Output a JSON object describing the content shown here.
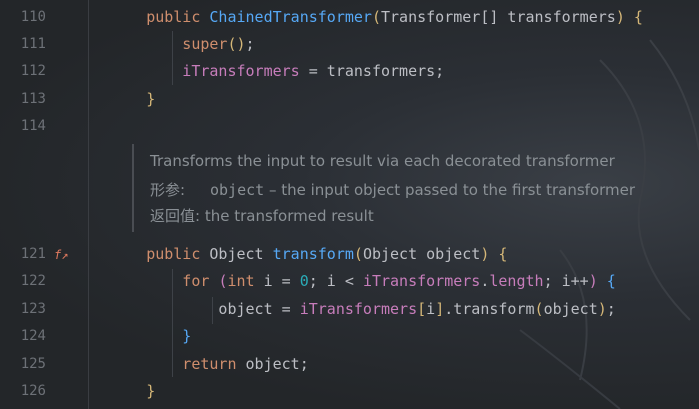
{
  "colors": {
    "keyword": "#cf8e6d",
    "function": "#56a8f5",
    "field": "#c77dbb",
    "number": "#2aacb8",
    "text": "#bcbec4",
    "line_number": "#6d7177",
    "doc_text": "#8a9095"
  },
  "lines": [
    {
      "num": "110",
      "tokens": [
        {
          "t": "public ",
          "c": "kw"
        },
        {
          "t": "ChainedTransformer",
          "c": "fn"
        },
        {
          "t": "(",
          "c": "br1"
        },
        {
          "t": "Transformer[] transformers",
          "c": "tx"
        },
        {
          "t": ")",
          "c": "br1"
        },
        {
          "t": " {",
          "c": "br1"
        }
      ]
    },
    {
      "num": "111",
      "tokens": [
        {
          "t": "    super",
          "c": "kw"
        },
        {
          "t": "()",
          "c": "br1"
        },
        {
          "t": ";",
          "c": "tx"
        }
      ]
    },
    {
      "num": "112",
      "tokens": [
        {
          "t": "    iTransformers",
          "c": "cl"
        },
        {
          "t": " = transformers;",
          "c": "tx"
        }
      ]
    },
    {
      "num": "113",
      "tokens": [
        {
          "t": "}",
          "c": "br1"
        }
      ]
    },
    {
      "num": "114",
      "tokens": []
    },
    {
      "num": "121",
      "icon": "override-icon",
      "tokens": [
        {
          "t": "public ",
          "c": "kw"
        },
        {
          "t": "Object ",
          "c": "tx"
        },
        {
          "t": "transform",
          "c": "fn"
        },
        {
          "t": "(",
          "c": "br1"
        },
        {
          "t": "Object object",
          "c": "tx"
        },
        {
          "t": ")",
          "c": "br1"
        },
        {
          "t": " {",
          "c": "br1"
        }
      ]
    },
    {
      "num": "122",
      "tokens": [
        {
          "t": "    for ",
          "c": "kw"
        },
        {
          "t": "(",
          "c": "br2"
        },
        {
          "t": "int ",
          "c": "kw"
        },
        {
          "t": "i = ",
          "c": "tx"
        },
        {
          "t": "0",
          "c": "num"
        },
        {
          "t": "; i < ",
          "c": "tx"
        },
        {
          "t": "iTransformers",
          "c": "cl"
        },
        {
          "t": ".",
          "c": "tx"
        },
        {
          "t": "length",
          "c": "cl"
        },
        {
          "t": "; i++",
          "c": "tx"
        },
        {
          "t": ")",
          "c": "br2"
        },
        {
          "t": " {",
          "c": "fn"
        }
      ]
    },
    {
      "num": "123",
      "tokens": [
        {
          "t": "        object = ",
          "c": "tx"
        },
        {
          "t": "iTransformers",
          "c": "cl"
        },
        {
          "t": "[",
          "c": "br1"
        },
        {
          "t": "i",
          "c": "tx"
        },
        {
          "t": "]",
          "c": "br1"
        },
        {
          "t": ".transform",
          "c": "tx"
        },
        {
          "t": "(",
          "c": "br1"
        },
        {
          "t": "object",
          "c": "tx"
        },
        {
          "t": ")",
          "c": "br1"
        },
        {
          "t": ";",
          "c": "tx"
        }
      ]
    },
    {
      "num": "124",
      "tokens": [
        {
          "t": "    }",
          "c": "fn"
        }
      ]
    },
    {
      "num": "125",
      "tokens": [
        {
          "t": "    return ",
          "c": "kw"
        },
        {
          "t": "object;",
          "c": "tx"
        }
      ]
    },
    {
      "num": "126",
      "tokens": [
        {
          "t": "}",
          "c": "br1"
        }
      ]
    }
  ],
  "doc": {
    "summary": "Transforms the input to result via each decorated transformer",
    "param_label": "形参:",
    "param_name": "object",
    "param_desc": " – the input object passed to the first transformer",
    "return_label": "返回值:",
    "return_desc": " the transformed result"
  }
}
